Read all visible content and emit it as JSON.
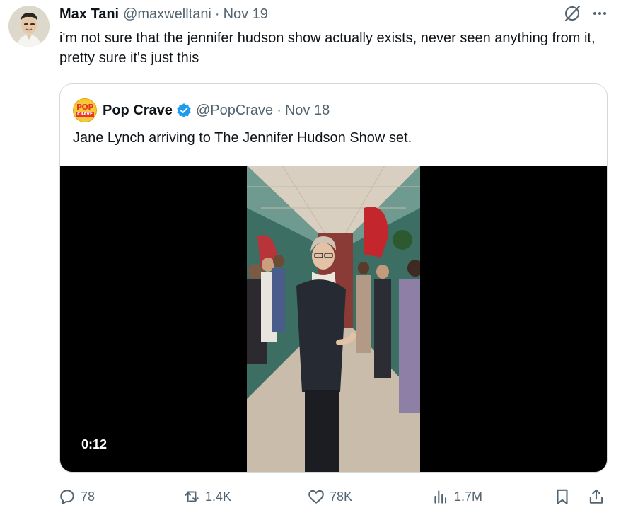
{
  "tweet": {
    "author_name": "Max Tani",
    "author_handle": "@maxwelltani",
    "separator": "·",
    "date": "Nov 19",
    "text": "i'm not sure that the jennifer hudson show actually exists, never seen anything from it, pretty sure it's just this"
  },
  "top_icons": [
    "grok-icon",
    "more-icon"
  ],
  "quote": {
    "avatar_text_top": "POP",
    "avatar_text_bottom": "CRAVE",
    "author_name": "Pop Crave",
    "author_handle": "@PopCrave",
    "separator": "·",
    "date": "Nov 18",
    "text": "Jane Lynch arriving to The Jennifer Hudson Show set.",
    "video": {
      "duration": "0:12"
    }
  },
  "actions": {
    "replies": "78",
    "reposts": "1.4K",
    "likes": "78K",
    "views": "1.7M"
  },
  "colors": {
    "text": "#0f1419",
    "secondary": "#536471",
    "border": "#cfd9de",
    "verified": "#1d9bf0"
  }
}
